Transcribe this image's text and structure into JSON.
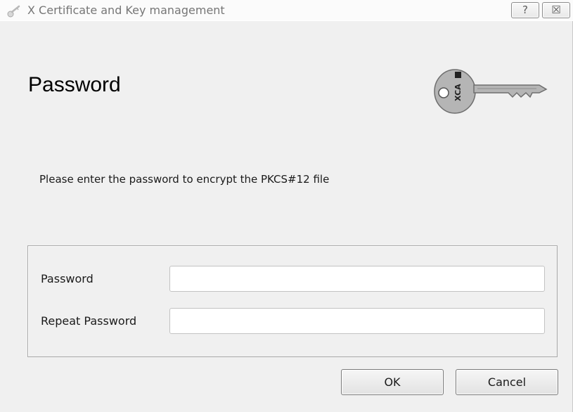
{
  "window": {
    "title": "X Certificate and Key management",
    "help_label": "?",
    "close_label": "☒"
  },
  "page": {
    "title": "Password",
    "instruction": "Please enter the password to encrypt the PKCS#12 file",
    "logo_icon": "xca-key-logo",
    "logo_text": "XCA"
  },
  "form": {
    "password_label": "Password",
    "password_value": "",
    "repeat_label": "Repeat Password",
    "repeat_value": ""
  },
  "buttons": {
    "ok_label": "OK",
    "cancel_label": "Cancel"
  },
  "colors": {
    "window_bg": "#f0f0f0",
    "key_fill": "#b5b5b5"
  }
}
